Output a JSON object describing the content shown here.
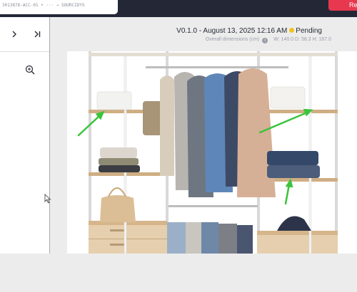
{
  "topbar": {
    "product_id": "3013878-ACC-01 • ··· → SOURCIDYS",
    "action_button": "Re"
  },
  "sidebar": {
    "expand_icon": "chevron-right-icon",
    "collapse_icon": "skip-end-icon",
    "zoom_icon": "zoom-in-icon"
  },
  "header": {
    "version": "V0.1.0 - August 13, 2025 12:16 AM",
    "status": "Pending",
    "status_color": "#f2c21b",
    "dims_label": "Overall dimensions (cm)",
    "width": "W: 140.0",
    "depth": "D: 58.3",
    "height": "H: 167.0"
  },
  "colors": {
    "topbar": "#242836",
    "accent": "#e8384f",
    "annotation_arrow": "#3cc43c"
  }
}
